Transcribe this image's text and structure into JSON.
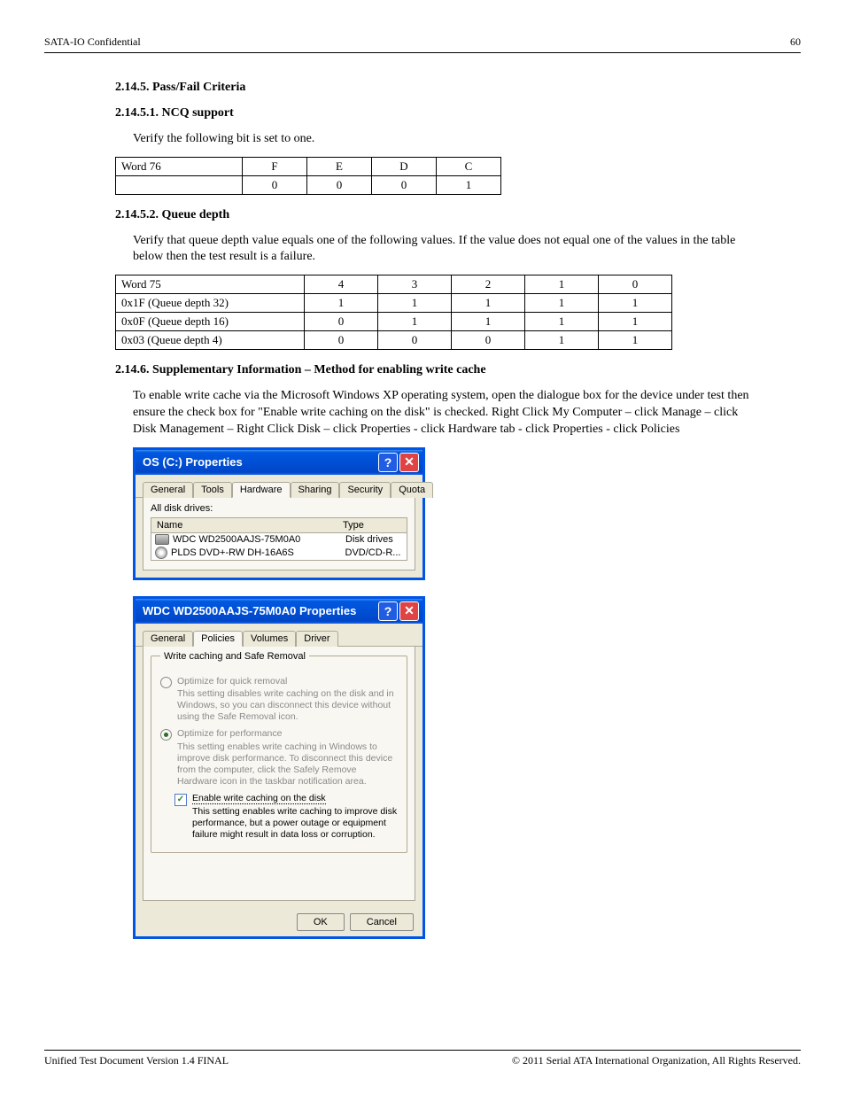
{
  "header": {
    "doc": "SATA-IO Confidential",
    "page": "60"
  },
  "text": {
    "title1": "2.14.5.  Pass/Fail Criteria",
    "title2": "2.14.5.1.  NCQ support",
    "para_verify": "Verify the following bit is set to one.",
    "table_ncq": {
      "r1": [
        "Word 76",
        "F",
        "E",
        "D",
        "C"
      ],
      "r2": [
        "",
        "0",
        "0",
        "0",
        "1"
      ]
    },
    "title3": "2.14.5.2.  Queue depth",
    "table_qd": {
      "r0": [
        "Word 75",
        "4",
        "3",
        "2",
        "1",
        "0"
      ],
      "r1": [
        "0x1F (Queue depth 32)",
        "1",
        "1",
        "1",
        "1",
        "1"
      ],
      "r2": [
        "0x0F (Queue depth 16)",
        "0",
        "1",
        "1",
        "1",
        "1"
      ],
      "r3": [
        "0x03 (Queue depth 4)",
        "0",
        "0",
        "0",
        "1",
        "1"
      ]
    },
    "para_qd": "Verify that queue depth value equals one of the following values.  If the value does not equal one of the values in the table below then the test result is a failure.",
    "title4": "2.14.6.  Supplementary Information – Method for enabling write cache",
    "para_wc": "To enable write cache via the Microsoft Windows XP operating system, open the dialogue box for the device under test then ensure the check box for \"Enable write caching on the disk\" is checked.  Right Click My Computer – click Manage – click Disk Management – Right Click Disk – click Properties - click Hardware tab - click Properties - click Policies",
    "footer_left": "Unified Test Document Version 1.4 FINAL",
    "footer_right": "© 2011 Serial ATA International Organization, All Rights Reserved."
  },
  "win1": {
    "title": "OS (C:) Properties",
    "tabs": [
      "General",
      "Tools",
      "Hardware",
      "Sharing",
      "Security",
      "Quota"
    ],
    "all_drives": "All disk drives:",
    "col_name": "Name",
    "col_type": "Type",
    "rows": [
      {
        "name": "WDC WD2500AAJS-75M0A0",
        "type": "Disk drives"
      },
      {
        "name": "PLDS DVD+-RW DH-16A6S",
        "type": "DVD/CD-R..."
      }
    ]
  },
  "win2": {
    "title": "WDC WD2500AAJS-75M0A0 Properties",
    "tabs": [
      "General",
      "Policies",
      "Volumes",
      "Driver"
    ],
    "legend": "Write caching and Safe Removal",
    "opt1_label": "Optimize for quick removal",
    "opt1_desc": "This setting disables write caching on the disk and in Windows, so you can disconnect this device without using the Safe Removal icon.",
    "opt2_label": "Optimize for performance",
    "opt2_desc": "This setting enables write caching in Windows to improve disk performance. To disconnect this device from the computer, click the Safely Remove Hardware icon in the taskbar notification area.",
    "chk_label": "Enable write caching on the disk",
    "chk_desc": "This setting enables write caching to improve disk performance, but a power outage or equipment failure might result in data loss or corruption.",
    "ok": "OK",
    "cancel": "Cancel"
  }
}
